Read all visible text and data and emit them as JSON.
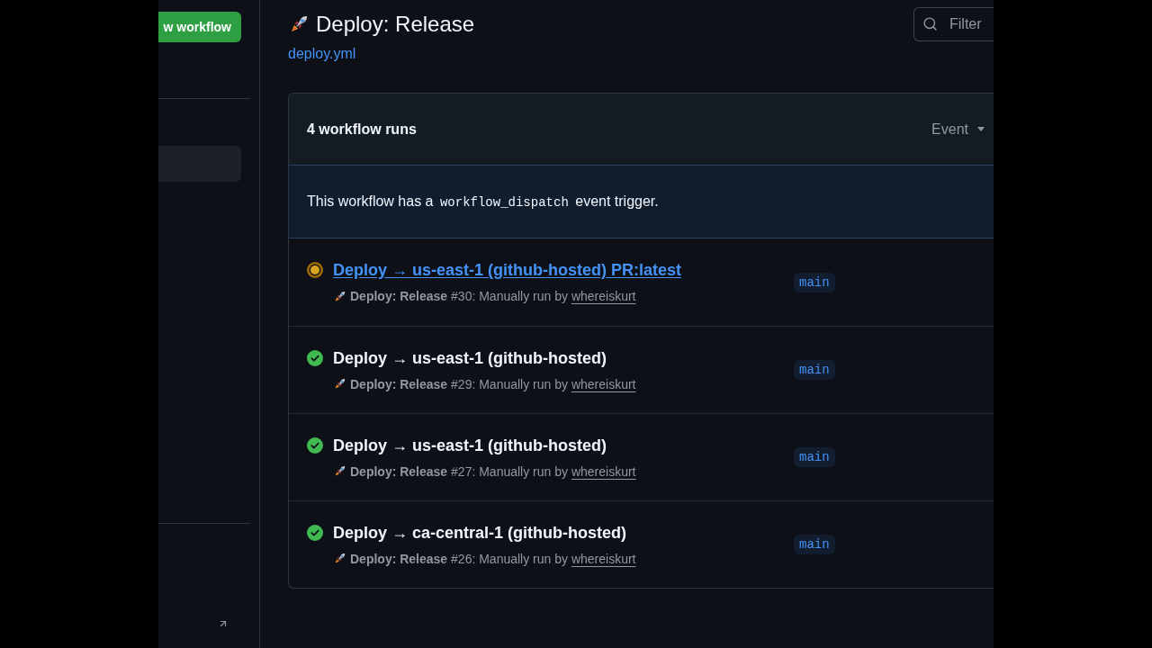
{
  "sidebar": {
    "new_workflow_button": "w workflow",
    "items": [
      {
        "selected": true
      }
    ]
  },
  "header": {
    "title": "Deploy: Release",
    "file_link": "deploy.yml",
    "filter": {
      "placeholder": "Filter"
    }
  },
  "runs_panel": {
    "count_label": "4 workflow runs",
    "filters": [
      "Event"
    ],
    "notice": {
      "before": "This workflow has a",
      "code": "workflow_dispatch",
      "after": "event trigger."
    },
    "runs": [
      {
        "kind": "running",
        "hovered": true,
        "title": "Deploy → us-east-1 (github-hosted) PR:latest",
        "description": "**Deploy: Release** #30: Manually run by",
        "actor": "whereiskurt",
        "branch": "main"
      },
      {
        "kind": "success",
        "hovered": false,
        "title": "Deploy → us-east-1 (github-hosted)",
        "description": "**Deploy: Release** #29: Manually run by",
        "actor": "whereiskurt",
        "branch": "main"
      },
      {
        "kind": "success",
        "hovered": false,
        "title": "Deploy → us-east-1 (github-hosted)",
        "description": "**Deploy: Release** #27: Manually run by",
        "actor": "whereiskurt",
        "branch": "main"
      },
      {
        "kind": "success",
        "hovered": false,
        "title": "Deploy → ca-central-1 (github-hosted)",
        "description": "**Deploy: Release** #26: Manually run by",
        "actor": "whereiskurt",
        "branch": "main"
      }
    ]
  }
}
